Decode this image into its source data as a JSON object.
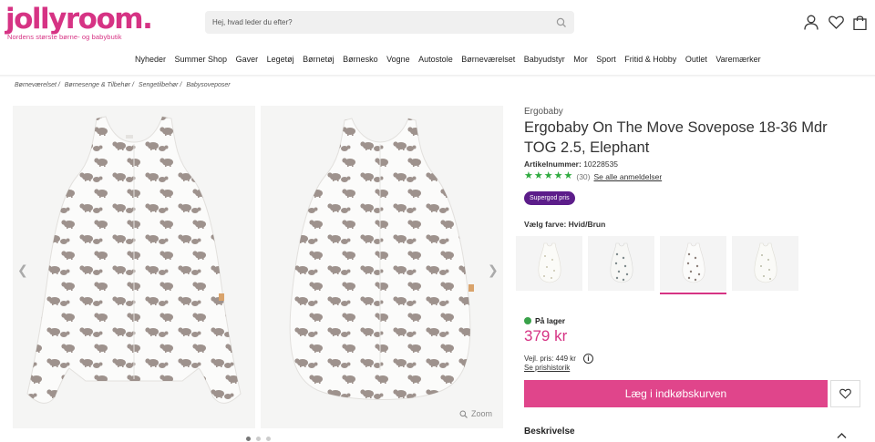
{
  "header": {
    "logo_text": "jollyroom.",
    "logo_tagline": "Nordens største børne- og babybutik",
    "search_placeholder": "Hej, hvad leder du efter?",
    "icons": [
      "user-icon",
      "heart-icon",
      "bag-icon"
    ]
  },
  "nav": {
    "items": [
      "Nyheder",
      "Summer Shop",
      "Gaver",
      "Legetøj",
      "Børnetøj",
      "Børnesko",
      "Vogne",
      "Autostole",
      "Børneværelset",
      "Babyudstyr",
      "Mor",
      "Sport",
      "Fritid & Hobby",
      "Outlet",
      "Varemærker"
    ]
  },
  "breadcrumb": [
    "Børneværelset /",
    "Børnesenge & Tilbehør /",
    "Sengetilbehør /",
    "Babysoveposer"
  ],
  "gallery": {
    "zoom_label": "Zoom",
    "dots": 3,
    "active_dot": 0
  },
  "product": {
    "brand": "Ergobaby",
    "title": "Ergobaby On The Move Sovepose 18-36 Mdr TOG 2.5, Elephant",
    "sku_label": "Artikelnummer:",
    "sku": "10228535",
    "rating": 5,
    "review_count": "(30)",
    "reviews_link": "Se alle anmeldelser",
    "badge": "Supergod pris",
    "color_label": "Vælg farve:",
    "color_value": "Hvid/Brun",
    "selected_swatch": 2,
    "stock": "På lager",
    "price": "379 kr",
    "rrp": "Vejl. pris: 449 kr",
    "price_history": "Se prishistorik",
    "cart_button": "Læg i indkøbskurven",
    "description_label": "Beskrivelse"
  },
  "colors": {
    "brand_pink": "#d63384",
    "cart_pink": "#e0458b",
    "stock_green": "#3aa24a",
    "badge_purple": "#5c1d8a",
    "star_green": "#2eaa3f"
  }
}
